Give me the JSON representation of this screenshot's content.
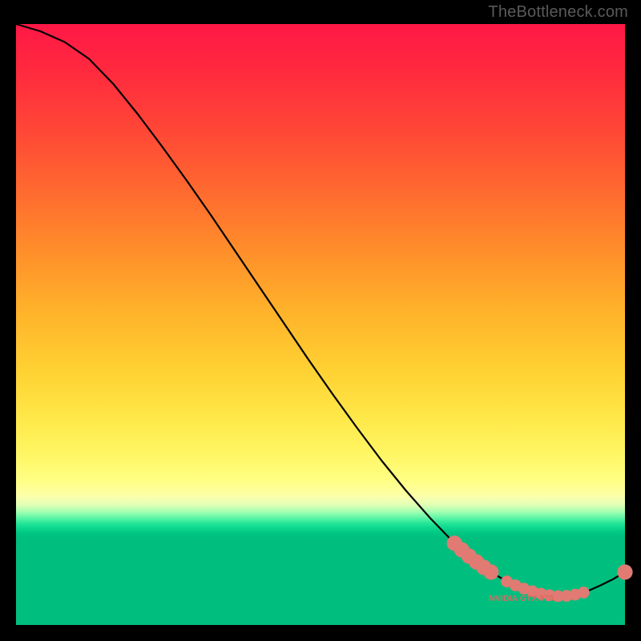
{
  "watermark": "TheBottleneck.com",
  "annotation_label": "NVIDIA GTX 970",
  "colors": {
    "dot": "#e07a72",
    "curve": "#000000"
  },
  "chart_data": {
    "type": "line",
    "title": "",
    "xlabel": "",
    "ylabel": "",
    "xlim": [
      0,
      100
    ],
    "ylim": [
      0,
      100
    ],
    "series": [
      {
        "name": "bottleneck-curve",
        "x": [
          0,
          4,
          8,
          12,
          16,
          20,
          24,
          28,
          32,
          36,
          40,
          44,
          48,
          52,
          56,
          60,
          64,
          68,
          72,
          74,
          76,
          78,
          80,
          82,
          84,
          86,
          88,
          90,
          92,
          94,
          96,
          98,
          100
        ],
        "y": [
          100,
          98.8,
          97.0,
          94.2,
          90.0,
          85.0,
          79.6,
          74.0,
          68.2,
          62.2,
          56.2,
          50.2,
          44.2,
          38.4,
          32.8,
          27.4,
          22.4,
          17.8,
          13.6,
          11.8,
          10.2,
          8.8,
          7.6,
          6.6,
          5.8,
          5.15,
          4.8,
          4.8,
          5.1,
          5.7,
          6.6,
          7.6,
          8.8
        ]
      }
    ],
    "markers": [
      {
        "x": 72.0,
        "y": 13.6,
        "r": 1.2
      },
      {
        "x": 73.2,
        "y": 12.5,
        "r": 1.2
      },
      {
        "x": 74.4,
        "y": 11.45,
        "r": 1.2
      },
      {
        "x": 75.6,
        "y": 10.5,
        "r": 1.2
      },
      {
        "x": 76.8,
        "y": 9.6,
        "r": 1.2
      },
      {
        "x": 78.0,
        "y": 8.8,
        "r": 1.2
      },
      {
        "x": 80.6,
        "y": 7.25,
        "r": 0.9
      },
      {
        "x": 82.0,
        "y": 6.6,
        "r": 0.9
      },
      {
        "x": 83.4,
        "y": 6.05,
        "r": 0.9
      },
      {
        "x": 84.8,
        "y": 5.6,
        "r": 0.9
      },
      {
        "x": 86.2,
        "y": 5.2,
        "r": 0.9
      },
      {
        "x": 87.6,
        "y": 4.95,
        "r": 0.9
      },
      {
        "x": 89.0,
        "y": 4.8,
        "r": 0.9
      },
      {
        "x": 90.4,
        "y": 4.85,
        "r": 0.9
      },
      {
        "x": 91.8,
        "y": 5.05,
        "r": 0.9
      },
      {
        "x": 93.2,
        "y": 5.4,
        "r": 0.9
      },
      {
        "x": 100.0,
        "y": 8.8,
        "r": 1.2
      }
    ],
    "annotation": {
      "x": 83,
      "y": 4.0,
      "text_key": "annotation_label"
    }
  }
}
